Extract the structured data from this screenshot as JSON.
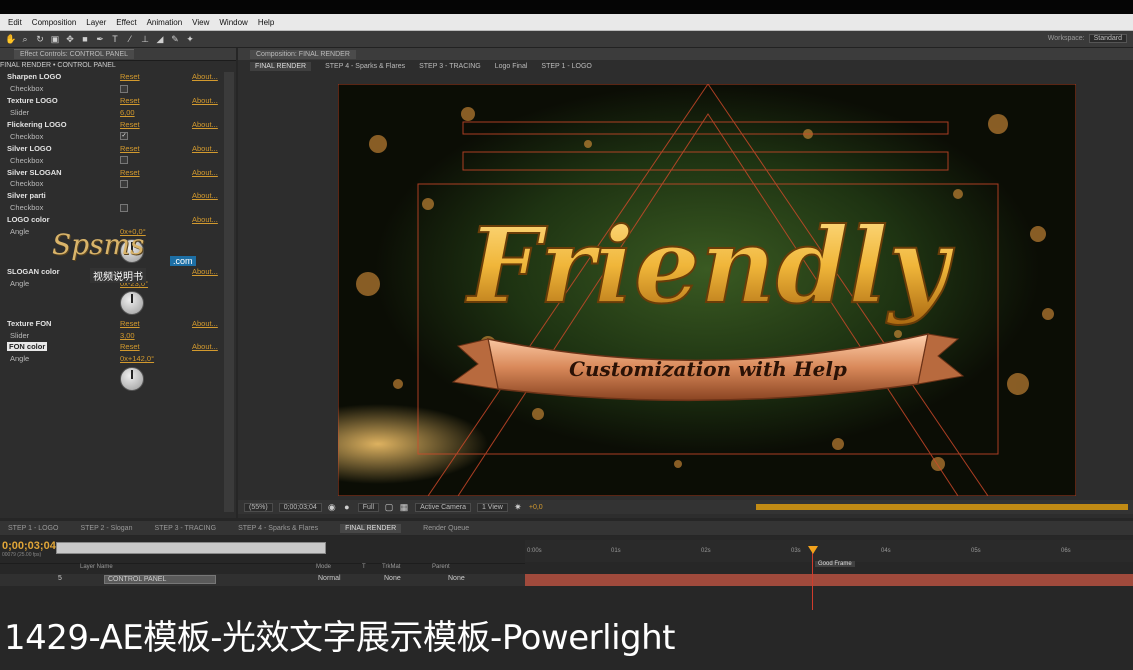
{
  "menu": {
    "items": [
      "Edit",
      "Composition",
      "Layer",
      "Effect",
      "Animation",
      "View",
      "Window",
      "Help"
    ]
  },
  "toolbar": {
    "workspace_label": "Workspace:",
    "workspace_value": "Standard"
  },
  "effect_controls": {
    "tab_label": "Effect Controls: CONTROL PANEL",
    "breadcrumb": "FINAL RENDER • CONTROL PANEL",
    "rows": [
      {
        "label": "Sharpen LOGO",
        "type": "group",
        "value": "Reset",
        "about": "About..."
      },
      {
        "label": "Checkbox",
        "type": "check",
        "value": ""
      },
      {
        "label": "Texture LOGO",
        "type": "group",
        "value": "Reset",
        "about": "About..."
      },
      {
        "label": "Slider",
        "type": "value",
        "value": "6,00"
      },
      {
        "label": "Flickering LOGO",
        "type": "group",
        "value": "Reset",
        "about": "About..."
      },
      {
        "label": "Checkbox",
        "type": "check",
        "value": "✓"
      },
      {
        "label": "Silver LOGO",
        "type": "group",
        "value": "Reset",
        "about": "About..."
      },
      {
        "label": "Checkbox",
        "type": "check",
        "value": ""
      },
      {
        "label": "Silver SLOGAN",
        "type": "group",
        "value": "Reset",
        "about": "About..."
      },
      {
        "label": "Checkbox",
        "type": "check",
        "value": ""
      },
      {
        "label": "Silver parti",
        "type": "group",
        "value": "",
        "about": "About..."
      },
      {
        "label": "Checkbox",
        "type": "check",
        "value": ""
      },
      {
        "label": "LOGO color",
        "type": "group",
        "value": "",
        "about": "About..."
      },
      {
        "label": "Angle",
        "type": "value",
        "value": "0x+0,0°"
      }
    ],
    "rows2": [
      {
        "label": "SLOGAN color",
        "type": "group",
        "value": "Reset",
        "about": "About..."
      },
      {
        "label": "Angle",
        "type": "value",
        "value": "0x-23,0°"
      }
    ],
    "rows3": [
      {
        "label": "Texture FON",
        "type": "group",
        "value": "Reset",
        "about": "About..."
      },
      {
        "label": "Slider",
        "type": "value",
        "value": "3,00"
      },
      {
        "label": "FON color",
        "type": "highlight",
        "value": "Reset",
        "about": "About..."
      },
      {
        "label": "Angle",
        "type": "value",
        "value": "0x+142,0°"
      }
    ]
  },
  "watermark": {
    "brand": "Spsms",
    "domain": ".com",
    "subtitle": "视频说明书"
  },
  "composition": {
    "tab_label": "Composition: FINAL RENDER",
    "crumbs": [
      "FINAL RENDER",
      "STEP 4 - Sparks & Flares",
      "STEP 3 - TRACING",
      "Logo Final",
      "STEP 1 - LOGO"
    ],
    "title_text": "Friendly",
    "ribbon_text": "Customization with Help",
    "zoom": "(55%)",
    "timecode": "0;00;03;04",
    "resolution": "Full",
    "camera": "Active Camera",
    "view": "1 View",
    "offset": "+0,0"
  },
  "timeline": {
    "tabs": [
      "STEP 1 - LOGO",
      "STEP 2 - Slogan",
      "STEP 3 - TRACING",
      "STEP 4 - Sparks & Flares",
      "FINAL RENDER",
      "Render Queue"
    ],
    "active_tab": "FINAL RENDER",
    "timecode": "0;00;03;04",
    "fps": "00079 (25.00 fps)",
    "headers": [
      "Layer Name",
      "Mode",
      "T",
      "TrkMat",
      "Parent"
    ],
    "layer": {
      "index": "5",
      "name": "CONTROL PANEL",
      "mode": "Normal",
      "trkmat": "None",
      "parent": "None"
    },
    "ruler": [
      "0:00s",
      "01s",
      "02s",
      "03s",
      "04s",
      "05s",
      "06s"
    ],
    "marker": "Good Frame"
  },
  "caption": "1429-AE模板-光效文字展示模板-Powerlight",
  "colors": {
    "accent_orange": "#d39a2e",
    "title_gold": "#f0b63a",
    "ribbon_copper": "#d9895a"
  }
}
